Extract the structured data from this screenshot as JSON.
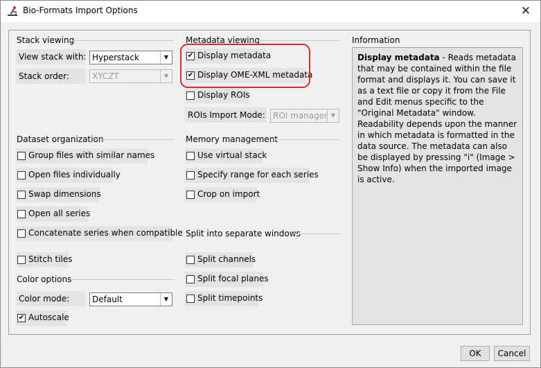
{
  "window": {
    "title": "Bio-Formats Import Options",
    "close_symbol": "✕"
  },
  "stack_viewing": {
    "title": "Stack viewing",
    "view_stack_label": "View stack with:",
    "view_stack_value": "Hyperstack",
    "stack_order_label": "Stack order:",
    "stack_order_value": "XYCZT"
  },
  "metadata_viewing": {
    "title": "Metadata viewing",
    "display_metadata": {
      "label": "Display metadata",
      "checked": true
    },
    "display_ome_xml": {
      "label": "Display OME-XML metadata",
      "checked": true
    },
    "display_rois": {
      "label": "Display ROIs",
      "checked": false
    },
    "rois_mode_label": "ROIs Import Mode:",
    "rois_mode_value": "ROI manager"
  },
  "information": {
    "title": "Information",
    "heading": "Display metadata",
    "text": " - Reads metadata that may be contained within the file format and displays it. You can save it as a text file or copy it from the File and Edit menus specific to the \"Original Metadata\" window. Readability depends upon the manner in which metadata is formatted in the data source. The metadata can also be displayed by pressing \"i\" (Image > Show Info) when the imported image is active."
  },
  "dataset_organization": {
    "title": "Dataset organization",
    "group_files": {
      "label": "Group files with similar names",
      "checked": false
    },
    "open_individually": {
      "label": "Open files individually",
      "checked": false
    },
    "swap_dimensions": {
      "label": "Swap dimensions",
      "checked": false
    },
    "open_all_series": {
      "label": "Open all series",
      "checked": false
    },
    "concatenate": {
      "label": "Concatenate series when compatible",
      "checked": false
    },
    "stitch_tiles": {
      "label": "Stitch tiles",
      "checked": false
    }
  },
  "memory_management": {
    "title": "Memory management",
    "virtual_stack": {
      "label": "Use virtual stack",
      "checked": false
    },
    "specify_range": {
      "label": "Specify range for each series",
      "checked": false
    },
    "crop_on_import": {
      "label": "Crop on import",
      "checked": false
    }
  },
  "split_windows": {
    "title": "Split into separate windows",
    "split_channels": {
      "label": "Split channels",
      "checked": false
    },
    "split_focal": {
      "label": "Split focal planes",
      "checked": false
    },
    "split_timepoints": {
      "label": "Split timepoints",
      "checked": false
    }
  },
  "color_options": {
    "title": "Color options",
    "color_mode_label": "Color mode:",
    "color_mode_value": "Default",
    "autoscale": {
      "label": "Autoscale",
      "checked": true
    }
  },
  "buttons": {
    "ok": "OK",
    "cancel": "Cancel"
  },
  "colors": {
    "highlight": "#e0262a"
  }
}
